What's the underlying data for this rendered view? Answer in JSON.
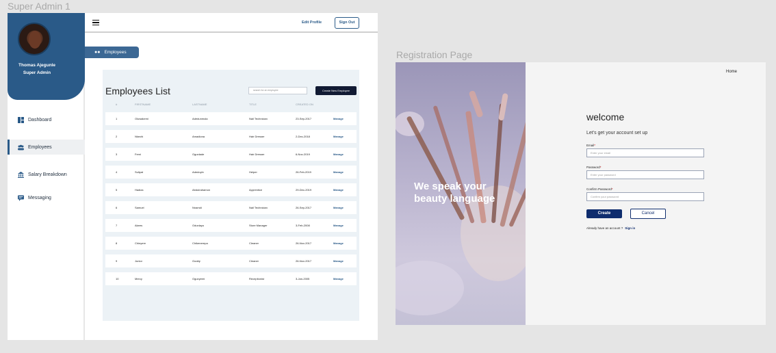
{
  "frames": {
    "admin_title": "Super Admin 1",
    "registration_title": "Registration Page"
  },
  "admin": {
    "user": {
      "name": "Thomas Ajegunle",
      "role": "Super Admin"
    },
    "nav": [
      {
        "label": "Dashboard",
        "icon": "dashboard-icon"
      },
      {
        "label": "Employees",
        "icon": "users-icon",
        "active": true
      },
      {
        "label": "Salary Breakdown",
        "icon": "bank-icon"
      },
      {
        "label": "Messaging",
        "icon": "message-icon"
      }
    ],
    "topbar": {
      "edit_profile": "Edit Profile",
      "sign_out": "Sign Out"
    },
    "tab": {
      "label": "Employees"
    },
    "list": {
      "title": "Employees List",
      "search_placeholder": "search for an employee",
      "create_button": "Create New Employee",
      "columns": [
        "#",
        "FIRSTNAME",
        "LASTNAME",
        "TITLE",
        "CREATED ON"
      ],
      "action_label": "Manage",
      "rows": [
        {
          "n": "1",
          "first": "Oluwakemi",
          "last": "Adedunmola",
          "title": "Nail Technician",
          "created": "23-Sep-2017"
        },
        {
          "n": "2",
          "first": "Nkechi",
          "last": "Amadiona",
          "title": "Hair Dresser",
          "created": "2-Dec-2018"
        },
        {
          "n": "3",
          "first": "Femi",
          "last": "Ogunlade",
          "title": "Hair Dresser",
          "created": "6-Nov-2019"
        },
        {
          "n": "4",
          "first": "Suliyat",
          "last": "Adedoyin",
          "title": "Helper",
          "created": "26-Feb-2019"
        },
        {
          "n": "5",
          "first": "Hadiza",
          "last": "Abdulrahamon",
          "title": "Apprentice",
          "created": "29-Dec-2019"
        },
        {
          "n": "6",
          "first": "Samuel",
          "last": "Nnamdi",
          "title": "Nail Technician",
          "created": "26-Sep-2017"
        },
        {
          "n": "7",
          "first": "Akees",
          "last": "Odunlayo",
          "title": "Store Manager",
          "created": "3-Feb-2008"
        },
        {
          "n": "8",
          "first": "Chinyere",
          "last": "Chikenerepa",
          "title": "Cleaner",
          "created": "26-Nov-2017"
        },
        {
          "n": "9",
          "first": "Junior",
          "last": "Goddy",
          "title": "Cleaner",
          "created": "26-Nov-2017"
        },
        {
          "n": "10",
          "first": "Mercy",
          "last": "Ogunyemi",
          "title": "Receptionist",
          "created": "3-Jan-2005"
        }
      ]
    }
  },
  "registration": {
    "hero_text": "We speak your beauty language",
    "home_link": "Home",
    "welcome": "welcome",
    "subtitle": "Let's get your account set up",
    "fields": [
      {
        "label": "Email",
        "placeholder": "Enter your email"
      },
      {
        "label": "Password",
        "placeholder": "Enter your password"
      },
      {
        "label": "Confirm Password",
        "placeholder": "Confirm your password"
      }
    ],
    "create_button": "Create",
    "cancel_button": "Cancel",
    "have_account": "Already have an account ?",
    "sign_in": "Sign in"
  },
  "colors": {
    "brand_blue": "#2a5a88",
    "navy": "#0f2d6e",
    "button_dark": "#111a33"
  }
}
